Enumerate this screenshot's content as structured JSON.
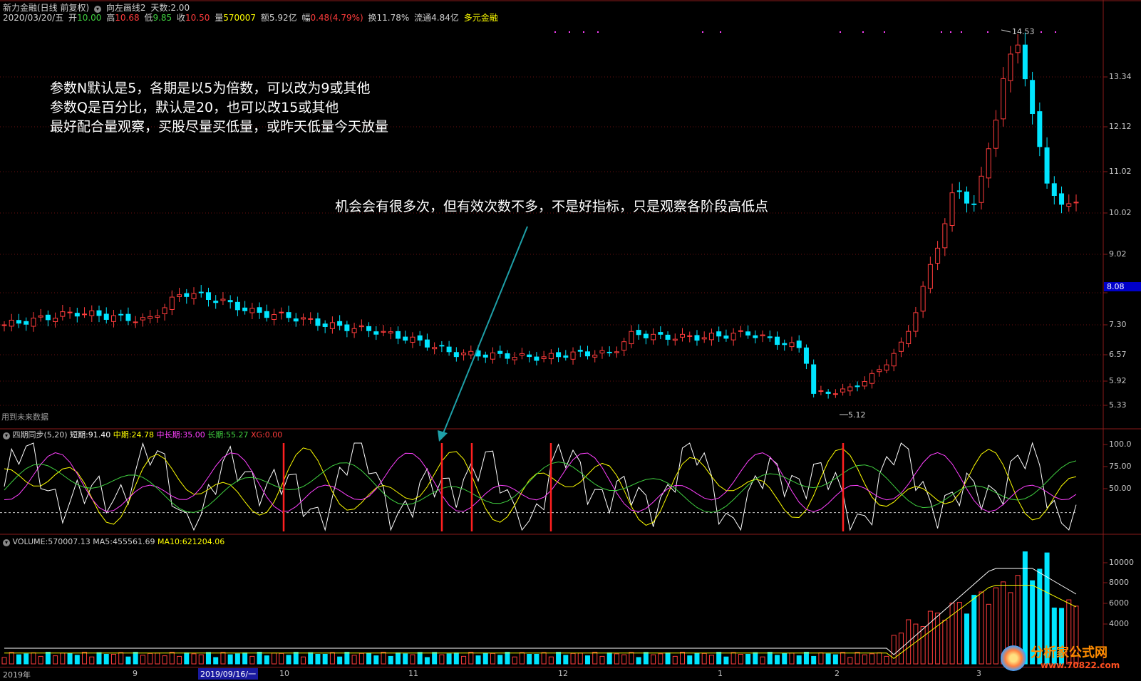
{
  "header": {
    "title": "新力金融(日线 前复权)",
    "drawing": "向左画线2",
    "days_label": "天数:",
    "days_value": "2.00",
    "date": "2020/03/20/五",
    "open_label": "开",
    "open": "10.00",
    "high_label": "高",
    "high": "10.68",
    "low_label": "低",
    "low": "9.85",
    "close_label": "收",
    "close": "10.50",
    "vol_label": "量",
    "vol": "570007",
    "amt_label": "额",
    "amt": "5.92亿",
    "chg_label": "幅",
    "chg": "0.48(4.79%)",
    "turn_label": "换",
    "turn": "11.78%",
    "float_label": "流通",
    "float": "4.84亿",
    "concept": "多元金融"
  },
  "price_axis": {
    "ticks": [
      "13.34",
      "12.12",
      "11.02",
      "10.02",
      "9.02",
      "8.08",
      "7.30",
      "6.57",
      "5.92",
      "5.33"
    ],
    "highlight": "8.08"
  },
  "annotations": {
    "line1": "参数N默认是5，各期是以5为倍数，可以改为9或其他",
    "line2": "参数Q是百分比，默认是20，也可以改15或其他",
    "line3": "最好配合量观察，买股尽量买低量，或昨天低量今天放量",
    "arrow_note": "机会会有很多次，但有效次数不多，不是好指标，只是观察各阶段高低点",
    "future_data": "用到未来数据",
    "max_label": "14.53",
    "min_label": "5.12"
  },
  "indicator": {
    "name": "四期同步(5,20)",
    "short_label": "短期:",
    "short": "91.40",
    "mid_label": "中期:",
    "mid": "24.78",
    "midlong_label": "中长期:",
    "midlong": "35.00",
    "long_label": "长期:",
    "long": "55.27",
    "xg_label": "XG:",
    "xg": "0.00",
    "ticks": [
      "100.0",
      "75.00",
      "50.00"
    ]
  },
  "volume": {
    "name": "VOLUME:",
    "value": "570007.13",
    "ma5_label": "MA5:",
    "ma5": "455561.69",
    "ma10_label": "MA10:",
    "ma10": "621204.06",
    "ticks": [
      "10000",
      "8000",
      "6000",
      "4000"
    ]
  },
  "time_axis": {
    "labels": [
      "2019年",
      "9",
      "2019/09/16/一",
      "10",
      "11",
      "12",
      "1",
      "2",
      "3"
    ]
  },
  "watermark": {
    "name": "分析家公式网",
    "url": "www.70822.com"
  },
  "colors": {
    "up": "#ff3c3c",
    "down": "#00e5ff",
    "magenta": "#ff40ff",
    "yellow": "#ffff00",
    "green": "#40d040",
    "white": "#ffffff"
  }
}
